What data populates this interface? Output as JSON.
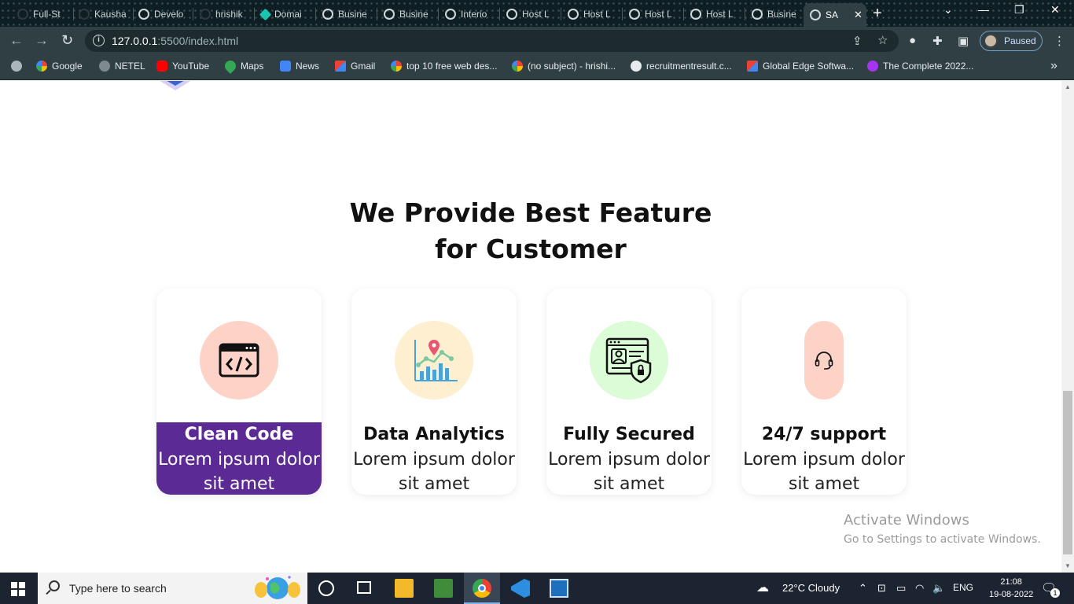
{
  "browser": {
    "tabs": [
      {
        "label": "Full-St"
      },
      {
        "label": "Kausha"
      },
      {
        "label": "Develo"
      },
      {
        "label": "hrishik"
      },
      {
        "label": "Domai"
      },
      {
        "label": "Busine"
      },
      {
        "label": "Busine"
      },
      {
        "label": "Interio"
      },
      {
        "label": "Host L"
      },
      {
        "label": "Host L"
      },
      {
        "label": "Host L"
      },
      {
        "label": "Host L"
      },
      {
        "label": "Busine"
      },
      {
        "label": "SA"
      }
    ],
    "address": {
      "host": "127.0.0.1",
      "rest": ":5500/index.html"
    },
    "profile_status": "Paused",
    "bookmarks": [
      {
        "label": "Google"
      },
      {
        "label": "NETEL"
      },
      {
        "label": "YouTube"
      },
      {
        "label": "Maps"
      },
      {
        "label": "News"
      },
      {
        "label": "Gmail"
      },
      {
        "label": "top 10 free web des..."
      },
      {
        "label": "(no subject) - hrishi..."
      },
      {
        "label": "recruitmentresult.c..."
      },
      {
        "label": "Global Edge Softwa..."
      },
      {
        "label": "The Complete 2022..."
      }
    ]
  },
  "page": {
    "heading_line1": "We Provide Best Feature",
    "heading_line2": "for Customer",
    "features": [
      {
        "title": "Clean Code",
        "desc_line1": "Lorem ipsum dolor",
        "desc_line2": "sit amet",
        "icon": "code-window-icon",
        "circle_color": "#fdd3c8"
      },
      {
        "title": "Data Analytics",
        "desc_line1": "Lorem ipsum dolor",
        "desc_line2": "sit amet",
        "icon": "analytics-chart-icon",
        "circle_color": "#fdefcf"
      },
      {
        "title": "Fully Secured",
        "desc_line1": "Lorem ipsum dolor",
        "desc_line2": "sit amet",
        "icon": "secure-profile-icon",
        "circle_color": "#dcfbd7"
      },
      {
        "title": "24/7 support",
        "desc_line1": "Lorem ipsum dolor",
        "desc_line2": "sit amet",
        "icon": "headset-icon",
        "circle_color": "#fdd3c8"
      }
    ],
    "highlight_color": "#5b2a94"
  },
  "watermark": {
    "title": "Activate Windows",
    "subtitle": "Go to Settings to activate Windows."
  },
  "taskbar": {
    "search_placeholder": "Type here to search",
    "weather": "22°C  Cloudy",
    "language": "ENG",
    "time": "21:08",
    "date": "19-08-2022",
    "notification_count": "1"
  }
}
